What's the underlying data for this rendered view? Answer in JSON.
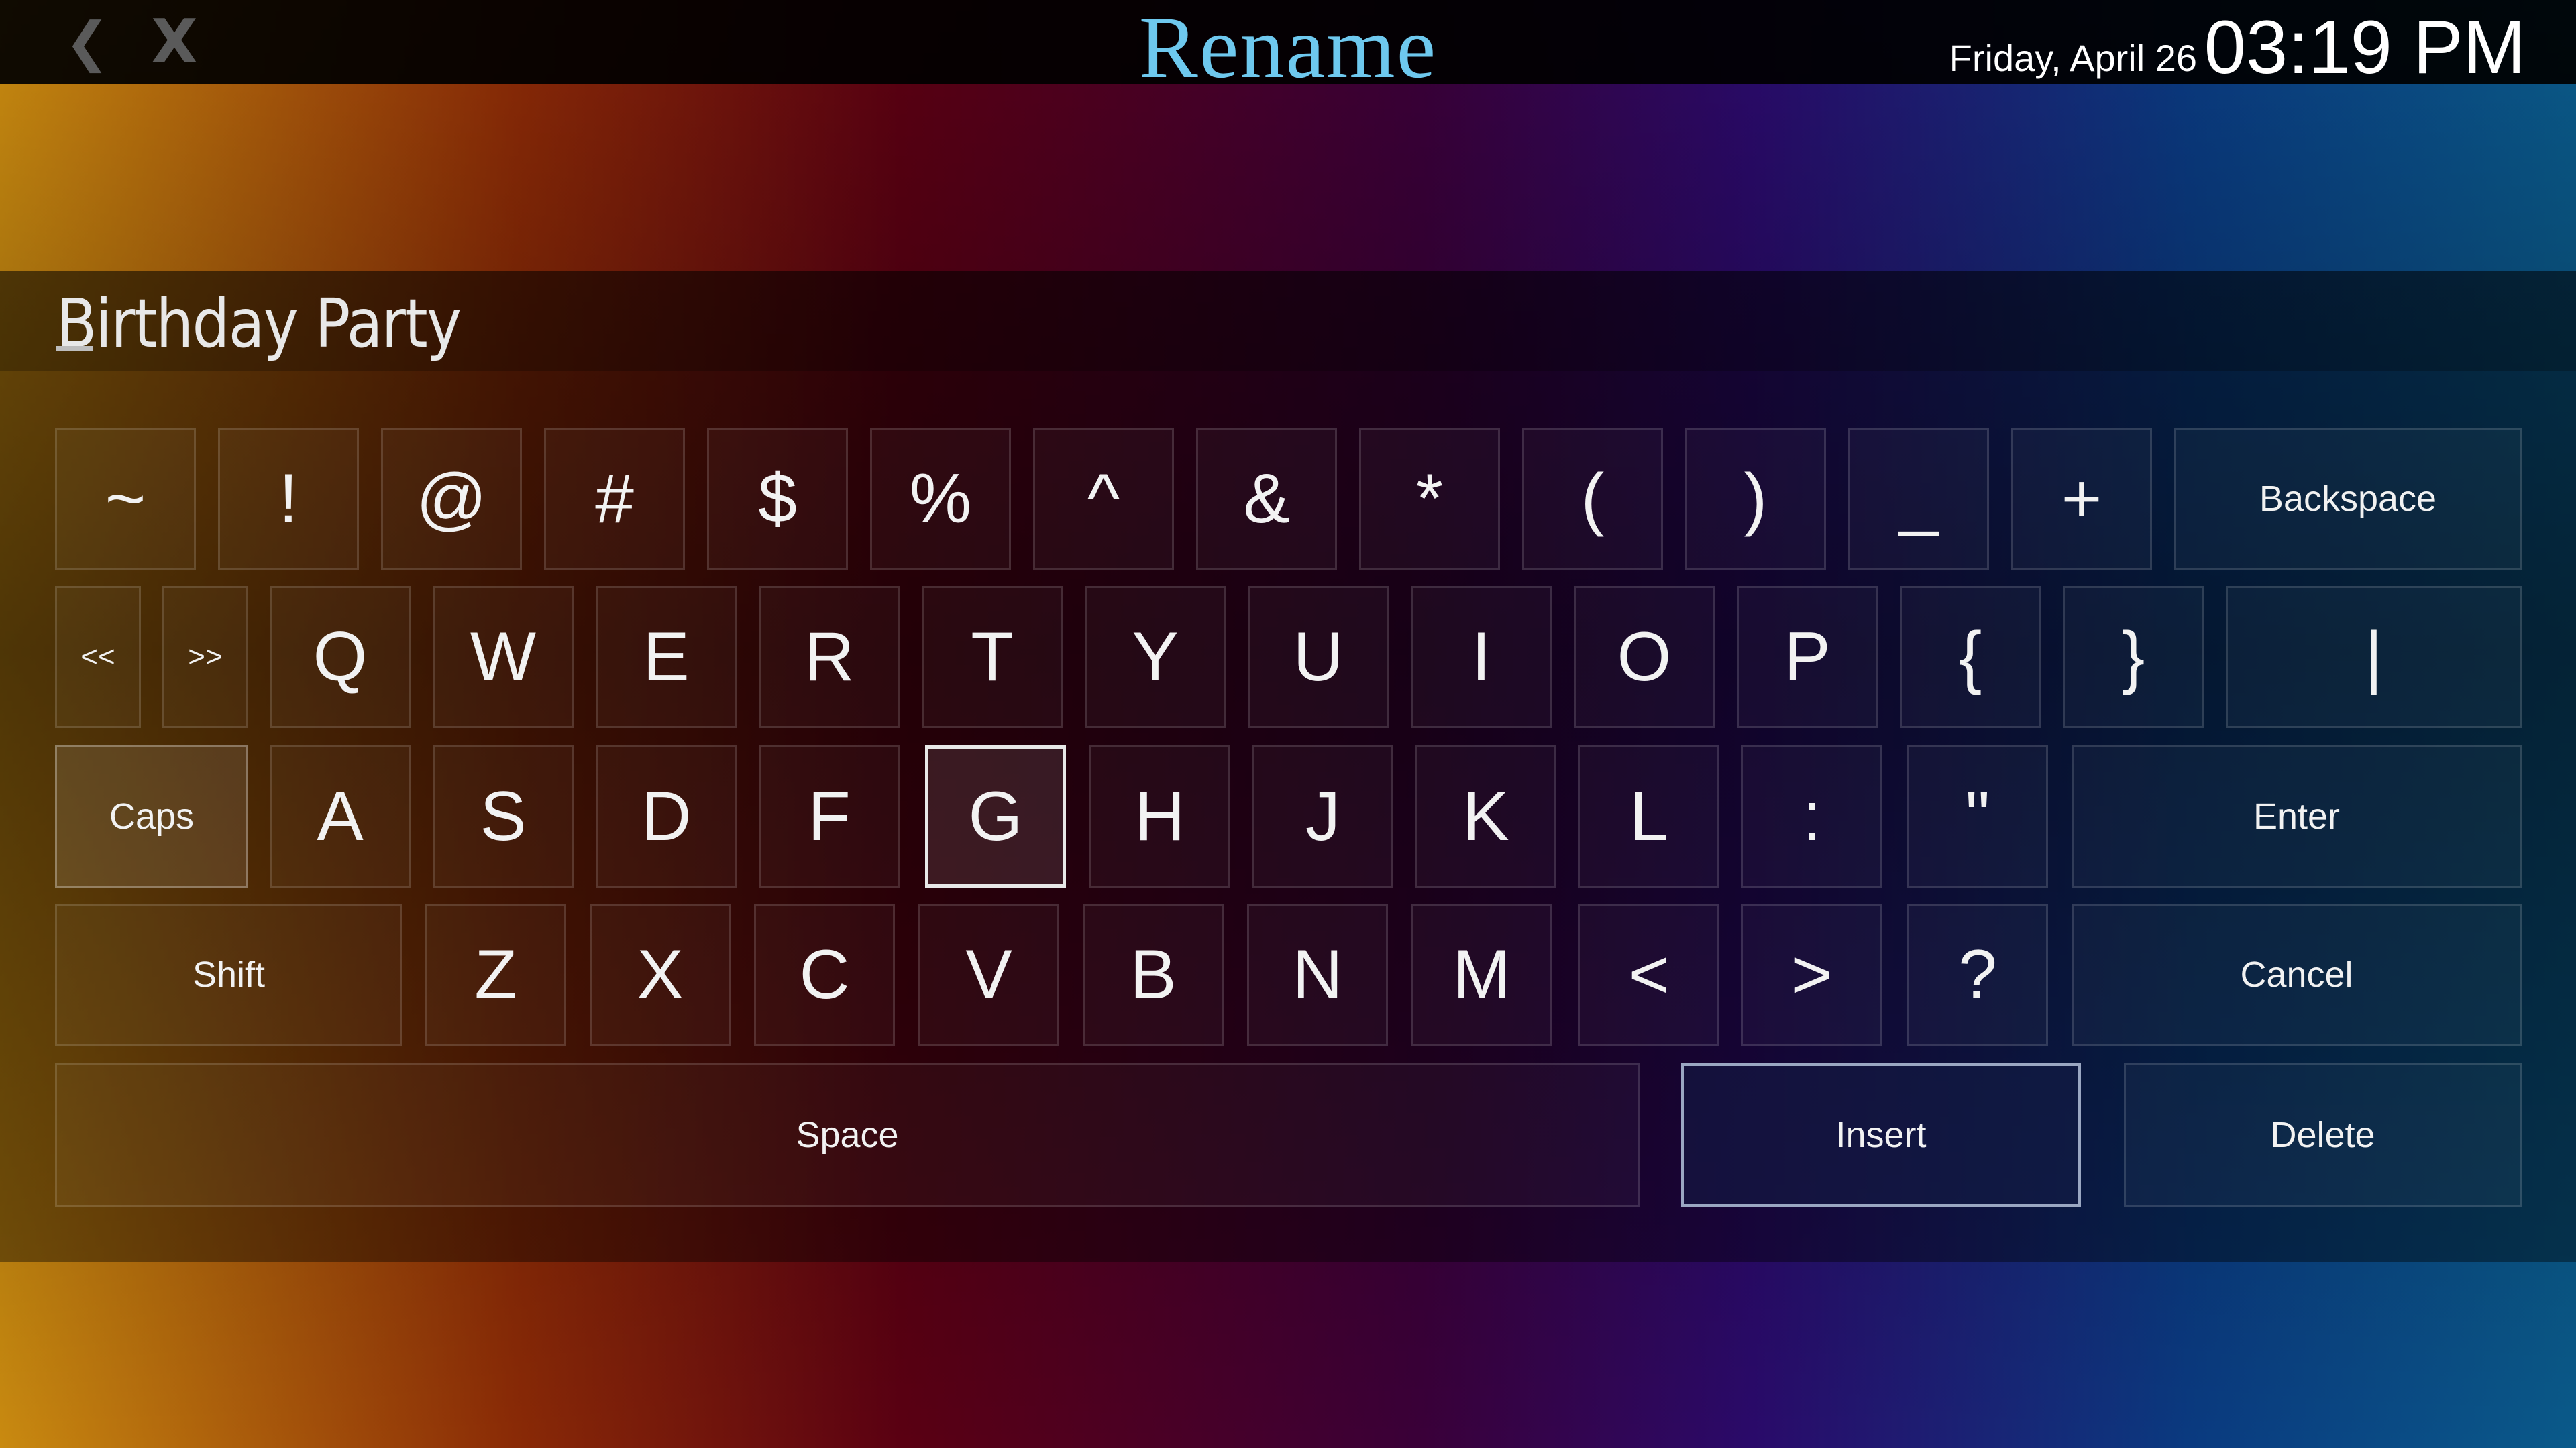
{
  "header": {
    "back_icon": "chevron-left-icon",
    "back_glyph": "❮",
    "close_icon": "close-icon",
    "close_glyph": "X",
    "title": "Rename",
    "date": "Friday, April 26",
    "time": "03:19 PM"
  },
  "input": {
    "value": "Birthday Party"
  },
  "keyboard": {
    "row1": [
      "~",
      "!",
      "@",
      "#",
      "$",
      "%",
      "^",
      "&",
      "*",
      "(",
      ")",
      "_",
      "+"
    ],
    "backspace": "Backspace",
    "prev": "<<",
    "next": ">>",
    "row2": [
      "Q",
      "W",
      "E",
      "R",
      "T",
      "Y",
      "U",
      "I",
      "O",
      "P",
      "{",
      "}",
      "|"
    ],
    "caps": "Caps",
    "row3": [
      "A",
      "S",
      "D",
      "F",
      "G",
      "H",
      "J",
      "K",
      "L",
      ":",
      "\""
    ],
    "enter": "Enter",
    "shift": "Shift",
    "row4": [
      "Z",
      "X",
      "C",
      "V",
      "B",
      "N",
      "M",
      "<",
      ">",
      "?"
    ],
    "cancel": "Cancel",
    "space": "Space",
    "insert": "Insert",
    "delete": "Delete",
    "focused_key": "G"
  }
}
